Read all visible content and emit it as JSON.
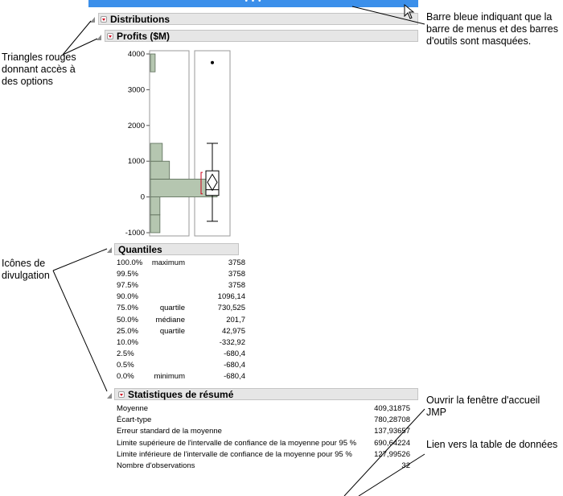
{
  "header": {
    "dots": "• • •"
  },
  "distributions": {
    "title": "Distributions"
  },
  "profits": {
    "title": "Profits ($M)",
    "axis_ticks": [
      "4000",
      "3000",
      "2000",
      "1000",
      "0",
      "-1000"
    ]
  },
  "chart_data": {
    "type": "bar",
    "orientation": "horizontal-histogram",
    "bins": [
      {
        "from": -1000,
        "to": -500,
        "count": 4
      },
      {
        "from": -500,
        "to": 0,
        "count": 4
      },
      {
        "from": 0,
        "to": 500,
        "count": 28
      },
      {
        "from": 500,
        "to": 1000,
        "count": 8
      },
      {
        "from": 1000,
        "to": 1500,
        "count": 5
      },
      {
        "from": 3500,
        "to": 4000,
        "count": 2
      }
    ],
    "ylim": [
      -1000,
      4000
    ],
    "boxplot": {
      "min": -680.4,
      "q1": 42.975,
      "median": 201.7,
      "q3": 730.525,
      "whisker_high": 1500,
      "outlier": 3758,
      "mean": 409.31875
    }
  },
  "quantiles": {
    "title": "Quantiles",
    "rows": [
      {
        "pct": "100.0%",
        "label": "maximum",
        "value": "3758"
      },
      {
        "pct": "99.5%",
        "label": "",
        "value": "3758"
      },
      {
        "pct": "97.5%",
        "label": "",
        "value": "3758"
      },
      {
        "pct": "90.0%",
        "label": "",
        "value": "1096,14"
      },
      {
        "pct": "75.0%",
        "label": "quartile",
        "value": "730,525"
      },
      {
        "pct": "50.0%",
        "label": "médiane",
        "value": "201,7"
      },
      {
        "pct": "25.0%",
        "label": "quartile",
        "value": "42,975"
      },
      {
        "pct": "10.0%",
        "label": "",
        "value": "-332,92"
      },
      {
        "pct": "2.5%",
        "label": "",
        "value": "-680,4"
      },
      {
        "pct": "0.5%",
        "label": "",
        "value": "-680,4"
      },
      {
        "pct": "0.0%",
        "label": "minimum",
        "value": "-680,4"
      }
    ]
  },
  "summary": {
    "title": "Statistiques de résumé",
    "rows": [
      {
        "label": "Moyenne",
        "value": "409,31875"
      },
      {
        "label": "Écart-type",
        "value": "780,28708"
      },
      {
        "label": "Erreur standard de la moyenne",
        "value": "137,93657"
      },
      {
        "label": "Limite supérieure de l'intervalle de confiance de la moyenne pour 95 %",
        "value": "690,64224"
      },
      {
        "label": "Limite inférieure de l'intervalle de confiance de la moyenne pour 95 %",
        "value": "127,99526"
      },
      {
        "label": "Nombre d'observations",
        "value": "32"
      }
    ]
  },
  "annotations": {
    "blue_bar": "Barre bleue indiquant que la barre de menus et des barres d'outils sont masquées.",
    "red_triangles": "Triangles rouges donnant accès à des options",
    "disclosure": "Icônes de divulgation",
    "home_window": "Ouvrir la fenêtre d'accueil JMP",
    "data_table": "Lien vers la table de données"
  },
  "colors": {
    "bar": "#3b8fea",
    "hist_fill": "#b5c6b0",
    "red": "#d0021b"
  }
}
